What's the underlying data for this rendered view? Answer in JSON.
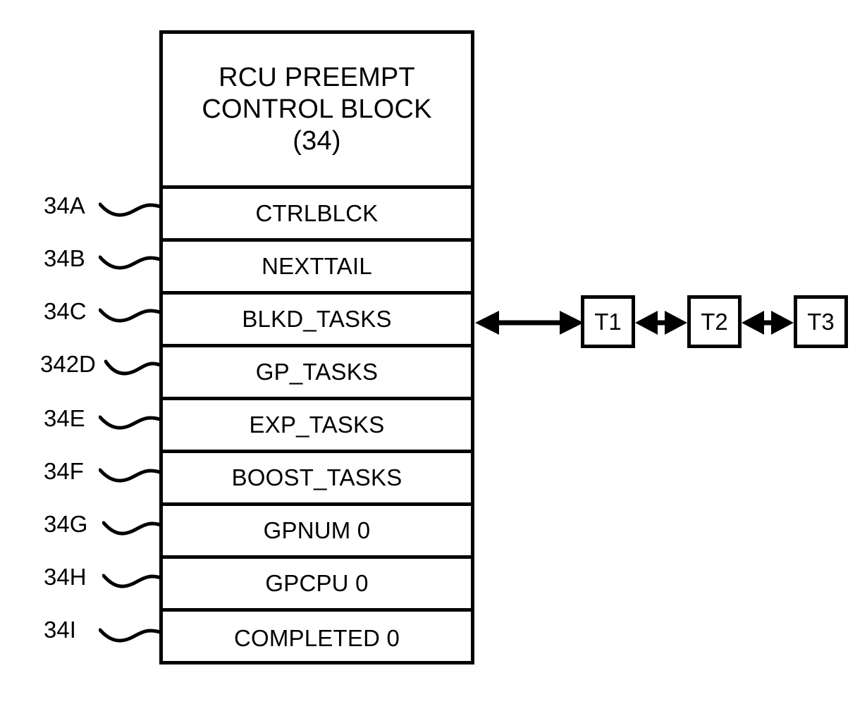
{
  "figure": {
    "title": "RCU PREEMPT CONTROL BLOCK (34)",
    "ink_color": "#000000",
    "background_color": "#ffffff"
  },
  "control_block": {
    "header_lines": [
      "RCU PREEMPT",
      "CONTROL BLOCK",
      "(34)"
    ],
    "rows": [
      {
        "ref": "34A",
        "field": "CTRLBLCK"
      },
      {
        "ref": "34B",
        "field": "NEXTTAIL"
      },
      {
        "ref": "34C",
        "field": "BLKD_TASKS"
      },
      {
        "ref": "342D",
        "field": "GP_TASKS"
      },
      {
        "ref": "34E",
        "field": "EXP_TASKS"
      },
      {
        "ref": "34F",
        "field": "BOOST_TASKS"
      },
      {
        "ref": "34G",
        "field": "GPNUM 0"
      },
      {
        "ref": "34H",
        "field": "GPCPU 0"
      },
      {
        "ref": "34I",
        "field": "COMPLETED 0"
      }
    ]
  },
  "task_chain": {
    "source_row": "BLKD_TASKS",
    "tasks": [
      {
        "label": "T1"
      },
      {
        "label": "T2"
      },
      {
        "label": "T3"
      }
    ],
    "links": [
      {
        "from": "BLKD_TASKS",
        "to": "T1",
        "style": "double-arrow"
      },
      {
        "from": "T1",
        "to": "T2",
        "style": "double-arrow"
      },
      {
        "from": "T2",
        "to": "T3",
        "style": "double-arrow"
      }
    ]
  }
}
